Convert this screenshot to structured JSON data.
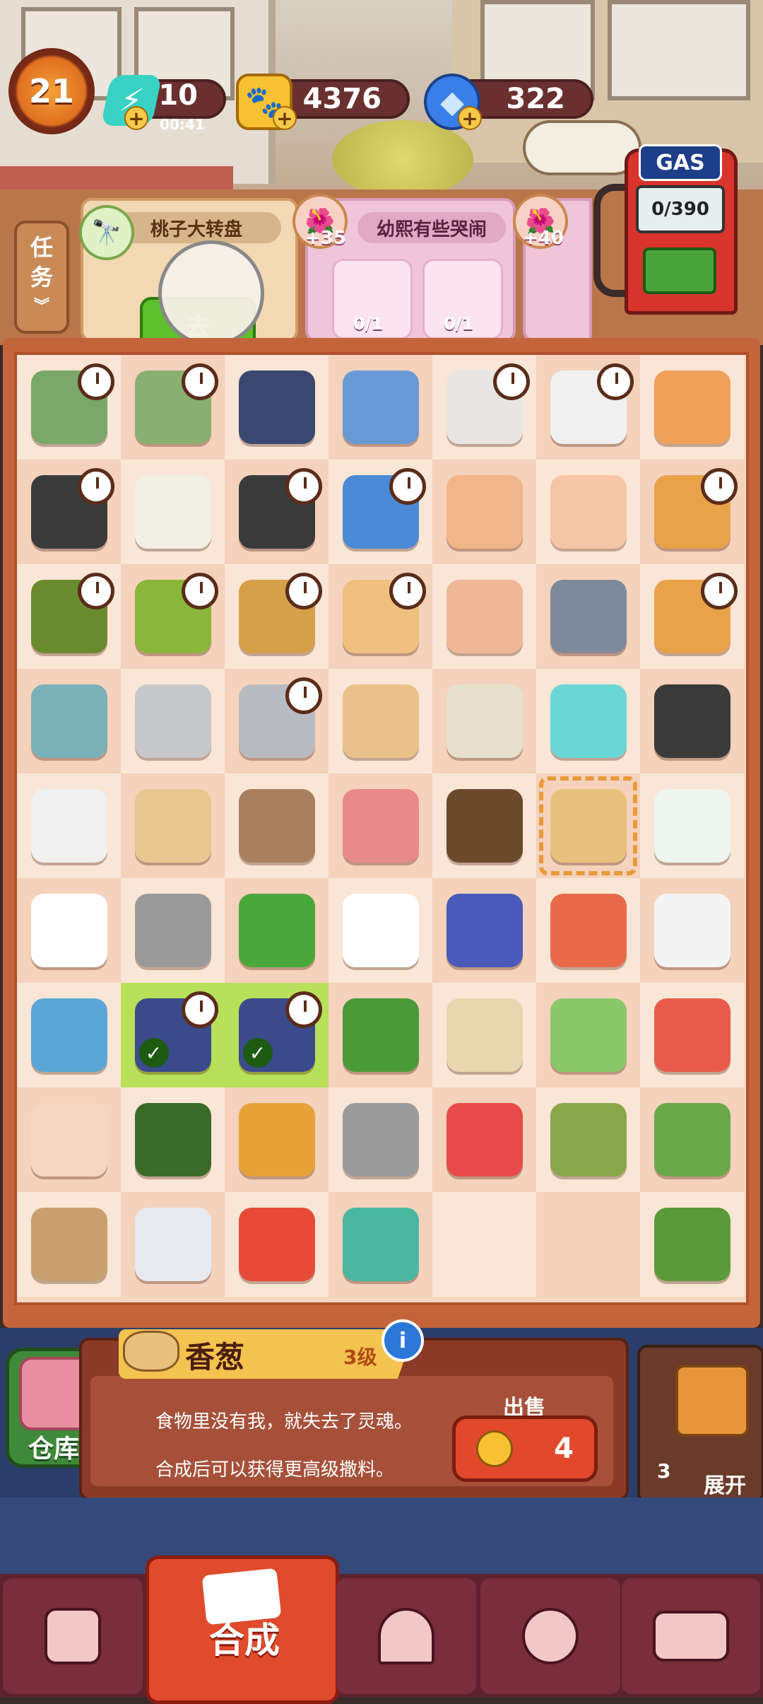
{
  "top_bar": {
    "level": "21",
    "energy": {
      "value": "10",
      "timer": "00:41",
      "icon": "lightning-icon",
      "color": "#3ad2c4"
    },
    "coins": {
      "value": "4376",
      "icon": "paw-coin-icon",
      "color": "#f6c233"
    },
    "gems": {
      "value": "322",
      "icon": "blue-gem-icon",
      "color": "#3a7ee8"
    }
  },
  "tasks": {
    "tab_label_1": "任",
    "tab_label_2": "务",
    "task1": {
      "title": "桃子大转盘",
      "icon": "telescope-icon",
      "button": "去"
    },
    "task2": {
      "title": "幼熙有些哭闹",
      "reward": "+35",
      "req1": "0/1",
      "req2": "0/1",
      "req1_icon": "gum-pack-icon",
      "req2_icon": "milk-tea-icon"
    },
    "task3": {
      "reward": "+40"
    }
  },
  "gas": {
    "label": "GAS",
    "value": "0/390"
  },
  "board": {
    "cells": [
      {
        "c": "#7aa86a",
        "t": 1
      },
      {
        "c": "#8ab071",
        "t": 1
      },
      {
        "c": "#3a4870",
        "t": 0
      },
      {
        "c": "#6a9ad6",
        "t": 0
      },
      {
        "c": "#e8e6e4",
        "t": 1
      },
      {
        "c": "#f0f0f0",
        "t": 1
      },
      {
        "c": "#f0a15a",
        "t": 0
      },
      {
        "c": "#3a3a3a",
        "t": 1
      },
      {
        "c": "#f2efe6",
        "t": 0
      },
      {
        "c": "#3a3a3a",
        "t": 1
      },
      {
        "c": "#4a8ad6",
        "t": 1
      },
      {
        "c": "#f2b58a",
        "t": 0
      },
      {
        "c": "#f5c6a5",
        "t": 0
      },
      {
        "c": "#e8a24a",
        "t": 1
      },
      {
        "c": "#6a8a2e",
        "t": 1
      },
      {
        "c": "#8ab63a",
        "t": 1
      },
      {
        "c": "#d6a04a",
        "t": 1
      },
      {
        "c": "#f0c080",
        "t": 1
      },
      {
        "c": "#f0b896",
        "t": 0
      },
      {
        "c": "#7e8a9a",
        "t": 0
      },
      {
        "c": "#e8a24a",
        "t": 1
      },
      {
        "c": "#7ab0b8",
        "t": 0
      },
      {
        "c": "#c6c8cc",
        "t": 0
      },
      {
        "c": "#b8bcc2",
        "t": 1
      },
      {
        "c": "#e8c28a",
        "t": 0
      },
      {
        "c": "#e6e0cc",
        "t": 0
      },
      {
        "c": "#6ad6d6",
        "t": 0
      },
      {
        "c": "#3a3a3a",
        "t": 0
      },
      {
        "c": "#f0f0f0",
        "t": 0
      },
      {
        "c": "#e8c890",
        "t": 0
      },
      {
        "c": "#a88060",
        "t": 0
      },
      {
        "c": "#e88a8a",
        "t": 0
      },
      {
        "c": "#6a4a2a",
        "t": 0
      },
      {
        "c": "#e8c27c",
        "t": 0,
        "sel": 1
      },
      {
        "c": "#eef4ee",
        "t": 0
      },
      {
        "c": "#ffffff",
        "t": 0
      },
      {
        "c": "#9a9a9a",
        "t": 0
      },
      {
        "c": "#4aa83a",
        "t": 0
      },
      {
        "c": "#ffffff",
        "t": 0
      },
      {
        "c": "#4a5ab8",
        "t": 0
      },
      {
        "c": "#e86a4a",
        "t": 0
      },
      {
        "c": "#f4f4f4",
        "t": 0
      },
      {
        "c": "#5aa6d6",
        "t": 0
      },
      {
        "c": "#3a4a8a",
        "t": 1,
        "chk": 1
      },
      {
        "c": "#3a4a8a",
        "t": 1,
        "chk": 1
      },
      {
        "c": "#4a9a3a",
        "t": 0
      },
      {
        "c": "#e8d6b0",
        "t": 0
      },
      {
        "c": "#8ac86a",
        "t": 0
      },
      {
        "c": "#e85a4a",
        "t": 0
      },
      {
        "c": "#f5d6c0",
        "t": 0
      },
      {
        "c": "#3a6a2a",
        "t": 0
      },
      {
        "c": "#e8a23a",
        "t": 0
      },
      {
        "c": "#9a9a9a",
        "t": 0
      },
      {
        "c": "#e84a4a",
        "t": 0
      },
      {
        "c": "#8aa64a",
        "t": 0
      },
      {
        "c": "#6aa84a",
        "t": 0
      },
      {
        "c": "#c8a070",
        "t": 0
      },
      {
        "c": "#e8e8f0",
        "t": 0
      },
      {
        "c": "#e84a3a",
        "t": 0
      },
      {
        "c": "#4ab8a0",
        "t": 0
      },
      {
        "c": "",
        "t": 0
      },
      {
        "c": "",
        "t": 0
      },
      {
        "c": "#5a9a3a",
        "t": 0
      }
    ]
  },
  "info": {
    "item_name": "香葱",
    "item_level": "3级",
    "info_icon": "i",
    "desc1": "食物里没有我，就失去了灵魂。",
    "desc2": "合成后可以获得更高级撒料。",
    "sell_label": "出售",
    "sell_value": "4",
    "warehouse_label": "仓库",
    "expand_count": "3",
    "expand_label": "展开"
  },
  "nav": {
    "items": [
      {
        "name": "shop-bag-icon"
      },
      {
        "label": "合成",
        "name": "merge-cards-icon"
      },
      {
        "name": "serving-dish-icon"
      },
      {
        "name": "map-pin-icon"
      },
      {
        "name": "bus-icon"
      }
    ]
  }
}
